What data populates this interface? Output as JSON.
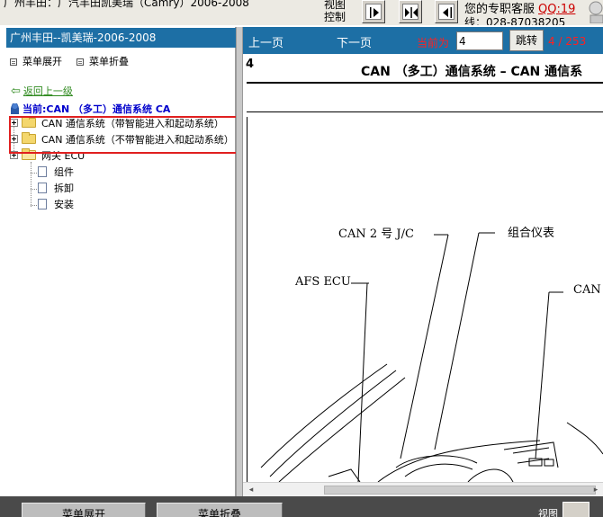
{
  "topbar": {
    "title": "广州丰田：广汽丰田凯美瑞（Camry）2006-2008",
    "view_control": "视图控制",
    "support": "您的专职客服",
    "qq": "QQ:19",
    "phone": "线：028-87038205"
  },
  "left": {
    "model_title": "广州丰田--凯美瑞-2006-2008",
    "expand_menu": "菜单展开",
    "collapse_menu": "菜单折叠",
    "back": "返回上一级",
    "current": "当前:CAN （多工）通信系统 CA",
    "tree": [
      {
        "label": "CAN 通信系统（带智能进入和起动系统）",
        "type": "folder"
      },
      {
        "label": "CAN 通信系统（不带智能进入和起动系统）",
        "type": "folder"
      },
      {
        "label": "网关 ECU",
        "type": "folder-open"
      },
      {
        "label": "组件",
        "type": "doc"
      },
      {
        "label": "拆卸",
        "type": "doc"
      },
      {
        "label": "安装",
        "type": "doc"
      }
    ]
  },
  "pagebar": {
    "prev": "上一页",
    "next": "下一页",
    "current_label": "当前为",
    "page_value": "4",
    "goto": "跳转",
    "total": "4 / 253"
  },
  "document": {
    "page_number": "4",
    "heading": "CAN （多工）通信系统 – CAN 通信系",
    "labels": {
      "can2jc": "CAN 2 号 J/C",
      "combination_meter": "组合仪表",
      "afs_ecu": "AFS ECU",
      "can_right": "CAN"
    }
  },
  "bottom": {
    "button1": "菜单展开",
    "button2": "菜单折叠",
    "view": "视图"
  }
}
